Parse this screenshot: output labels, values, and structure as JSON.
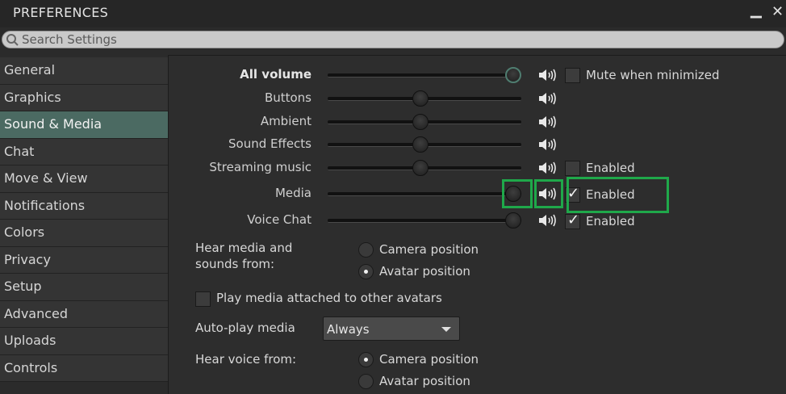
{
  "window": {
    "title": "PREFERENCES",
    "minimize_glyph": "▁",
    "close_glyph": "✕"
  },
  "search": {
    "placeholder": "Search Settings",
    "icon": "search-icon"
  },
  "sidebar": {
    "items": [
      {
        "label": "General"
      },
      {
        "label": "Graphics"
      },
      {
        "label": "Sound & Media",
        "active": true
      },
      {
        "label": "Chat"
      },
      {
        "label": "Move & View"
      },
      {
        "label": "Notifications"
      },
      {
        "label": "Colors"
      },
      {
        "label": "Privacy"
      },
      {
        "label": "Setup"
      },
      {
        "label": "Advanced"
      },
      {
        "label": "Uploads"
      },
      {
        "label": "Controls"
      }
    ]
  },
  "sound": {
    "sliders": [
      {
        "label": "All volume",
        "value": 1.0
      },
      {
        "label": "Buttons",
        "value": 0.5
      },
      {
        "label": "Ambient",
        "value": 0.5
      },
      {
        "label": "Sound Effects",
        "value": 0.5
      },
      {
        "label": "Streaming music",
        "value": 0.5
      },
      {
        "label": "Media",
        "value": 1.0
      },
      {
        "label": "Voice Chat",
        "value": 1.0
      }
    ],
    "mute_when_minimized": {
      "label": "Mute when minimized",
      "checked": false
    },
    "streaming_enabled": {
      "label": "Enabled",
      "checked": false
    },
    "media_enabled": {
      "label": "Enabled",
      "checked": true
    },
    "voice_enabled": {
      "label": "Enabled",
      "checked": true
    },
    "hear_media": {
      "label_line1": "Hear media and",
      "label_line2": "sounds from:",
      "options": [
        {
          "label": "Camera position",
          "selected": false
        },
        {
          "label": "Avatar position",
          "selected": true
        }
      ]
    },
    "play_media_attached": {
      "label": "Play media attached to other avatars",
      "checked": false
    },
    "auto_play": {
      "label": "Auto-play media",
      "value": "Always"
    },
    "hear_voice": {
      "label": "Hear voice from:",
      "options": [
        {
          "label": "Camera position",
          "selected": true
        },
        {
          "label": "Avatar position",
          "selected": false
        }
      ]
    }
  },
  "colors": {
    "active_tab": "#4b6a62",
    "highlight": "#1fa84a",
    "background": "#2b2b2b"
  }
}
